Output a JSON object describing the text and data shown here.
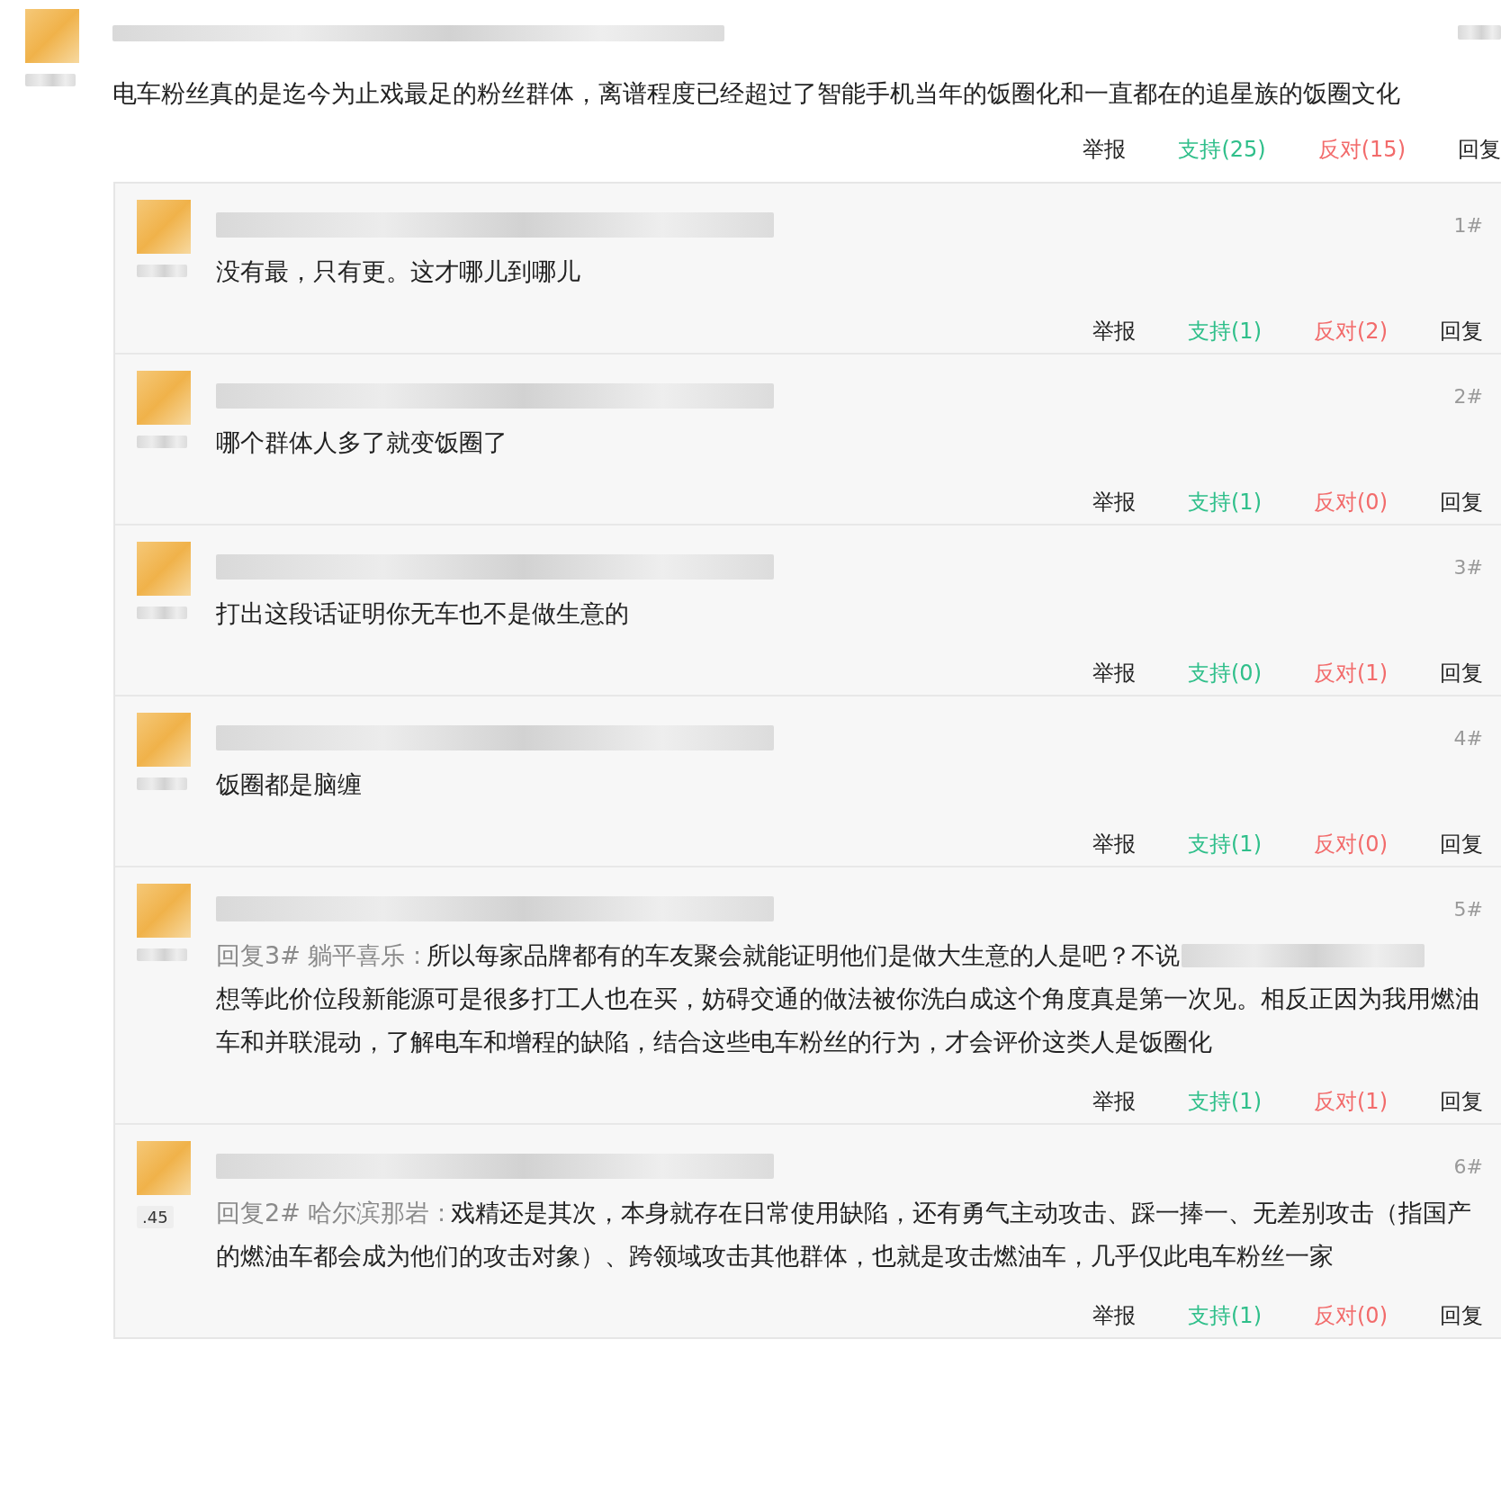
{
  "post": {
    "text": "电车粉丝真的是迄今为止戏最足的粉丝群体，离谱程度已经超过了智能手机当年的饭圈化和一直都在的追星族的饭圈文化",
    "actions": [
      {
        "kind": "report",
        "label": "举报"
      },
      {
        "kind": "support",
        "label": "支持(25)"
      },
      {
        "kind": "oppose",
        "label": "反对(15)"
      },
      {
        "kind": "reply",
        "label": "回复"
      }
    ]
  },
  "replies": [
    {
      "floor": "1#",
      "segments": [
        {
          "kind": "text",
          "text": "没有最，只有更。这才哪儿到哪儿"
        }
      ],
      "actions": [
        {
          "kind": "report",
          "label": "举报"
        },
        {
          "kind": "support",
          "label": "支持(1)"
        },
        {
          "kind": "oppose",
          "label": "反对(2)"
        },
        {
          "kind": "reply",
          "label": "回复"
        }
      ]
    },
    {
      "floor": "2#",
      "segments": [
        {
          "kind": "text",
          "text": "哪个群体人多了就变饭圈了"
        }
      ],
      "actions": [
        {
          "kind": "report",
          "label": "举报"
        },
        {
          "kind": "support",
          "label": "支持(1)"
        },
        {
          "kind": "oppose",
          "label": "反对(0)"
        },
        {
          "kind": "reply",
          "label": "回复"
        }
      ]
    },
    {
      "floor": "3#",
      "segments": [
        {
          "kind": "text",
          "text": "打出这段话证明你无车也不是做生意的"
        }
      ],
      "actions": [
        {
          "kind": "report",
          "label": "举报"
        },
        {
          "kind": "support",
          "label": "支持(0)"
        },
        {
          "kind": "oppose",
          "label": "反对(1)"
        },
        {
          "kind": "reply",
          "label": "回复"
        }
      ]
    },
    {
      "floor": "4#",
      "segments": [
        {
          "kind": "text",
          "text": "饭圈都是脑缠"
        }
      ],
      "actions": [
        {
          "kind": "report",
          "label": "举报"
        },
        {
          "kind": "support",
          "label": "支持(1)"
        },
        {
          "kind": "oppose",
          "label": "反对(0)"
        },
        {
          "kind": "reply",
          "label": "回复"
        }
      ]
    },
    {
      "floor": "5#",
      "segments": [
        {
          "kind": "prefix",
          "text": "回复3# 躺平喜乐 :"
        },
        {
          "kind": "text",
          "text": "所以每家品牌都有的车友聚会就能证明他们是做大生意的人是吧？不说"
        },
        {
          "kind": "blur"
        },
        {
          "kind": "text",
          "text": "想等此价位段新能源可是很多打工人也在买，妨碍交通的做法被你洗白成这个角度真是第一次见。相反正因为我用燃油车和并联混动，了解电车和增程的缺陷，结合这些电车粉丝的行为，才会评价这类人是饭圈化"
        }
      ],
      "actions": [
        {
          "kind": "report",
          "label": "举报"
        },
        {
          "kind": "support",
          "label": "支持(1)"
        },
        {
          "kind": "oppose",
          "label": "反对(1)"
        },
        {
          "kind": "reply",
          "label": "回复"
        }
      ]
    },
    {
      "floor": "6#",
      "badge": ".45",
      "segments": [
        {
          "kind": "prefix",
          "text": "回复2# 哈尔滨那岩 :"
        },
        {
          "kind": "text",
          "text": "戏精还是其次，本身就存在日常使用缺陷，还有勇气主动攻击、踩一捧一、无差别攻击（指国产的燃油车都会成为他们的攻击对象）、跨领域攻击其他群体，也就是攻击燃油车，几乎仅此电车粉丝一家"
        }
      ],
      "actions": [
        {
          "kind": "report",
          "label": "举报"
        },
        {
          "kind": "support",
          "label": "支持(1)"
        },
        {
          "kind": "oppose",
          "label": "反对(0)"
        },
        {
          "kind": "reply",
          "label": "回复"
        }
      ]
    }
  ]
}
